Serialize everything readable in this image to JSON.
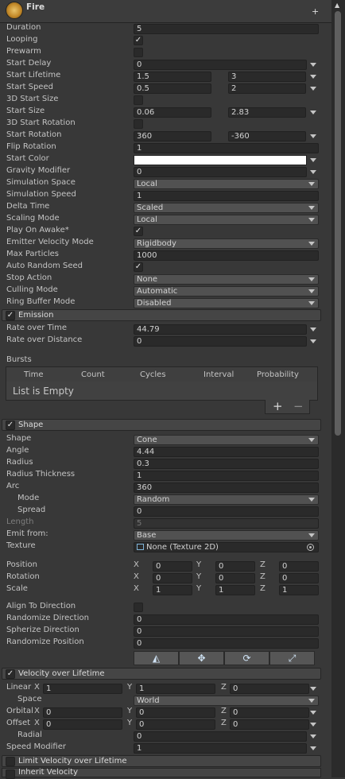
{
  "header": {
    "title": "Fire"
  },
  "main": [
    {
      "label": "Duration",
      "kind": "field",
      "value": "5"
    },
    {
      "label": "Looping",
      "kind": "check",
      "checked": true
    },
    {
      "label": "Prewarm",
      "kind": "check",
      "checked": false
    },
    {
      "label": "Start Delay",
      "kind": "field_arrow",
      "value": "0"
    },
    {
      "label": "Start Lifetime",
      "kind": "two_arrow",
      "value": "1.5",
      "value2": "3"
    },
    {
      "label": "Start Speed",
      "kind": "two_arrow",
      "value": "0.5",
      "value2": "2"
    },
    {
      "label": "3D Start Size",
      "kind": "check",
      "checked": false
    },
    {
      "label": "Start Size",
      "kind": "two_arrow",
      "value": "0.06",
      "value2": "2.83"
    },
    {
      "label": "3D Start Rotation",
      "kind": "check",
      "checked": false
    },
    {
      "label": "Start Rotation",
      "kind": "two_arrow",
      "value": "360",
      "value2": "-360"
    },
    {
      "label": "Flip Rotation",
      "kind": "field",
      "value": "1"
    },
    {
      "label": "Start Color",
      "kind": "color",
      "color": "#ffffff"
    },
    {
      "label": "Gravity Modifier",
      "kind": "field_arrow",
      "value": "0"
    },
    {
      "label": "Simulation Space",
      "kind": "dropdown",
      "value": "Local"
    },
    {
      "label": "Simulation Speed",
      "kind": "field",
      "value": "1"
    },
    {
      "label": "Delta Time",
      "kind": "dropdown",
      "value": "Scaled"
    },
    {
      "label": "Scaling Mode",
      "kind": "dropdown",
      "value": "Local"
    },
    {
      "label": "Play On Awake*",
      "kind": "check",
      "checked": true
    },
    {
      "label": "Emitter Velocity Mode",
      "kind": "dropdown",
      "value": "Rigidbody"
    },
    {
      "label": "Max Particles",
      "kind": "field",
      "value": "1000"
    },
    {
      "label": "Auto Random Seed",
      "kind": "check",
      "checked": true
    },
    {
      "label": "Stop Action",
      "kind": "dropdown",
      "value": "None"
    },
    {
      "label": "Culling Mode",
      "kind": "dropdown",
      "value": "Automatic"
    },
    {
      "label": "Ring Buffer Mode",
      "kind": "dropdown",
      "value": "Disabled"
    }
  ],
  "emission": {
    "title": "Emission",
    "rows": [
      {
        "label": "Rate over Time",
        "value": "44.79"
      },
      {
        "label": "Rate over Distance",
        "value": "0"
      }
    ],
    "bursts_label": "Bursts",
    "columns": [
      "Time",
      "Count",
      "Cycles",
      "Interval",
      "Probability"
    ],
    "empty_text": "List is Empty",
    "add": "+",
    "remove": "−"
  },
  "shape": {
    "title": "Shape",
    "rows": [
      {
        "label": "Shape",
        "kind": "dropdown",
        "value": "Cone"
      },
      {
        "label": "Angle",
        "kind": "field",
        "value": "4.44"
      },
      {
        "label": "Radius",
        "kind": "field",
        "value": "0.3"
      },
      {
        "label": "Radius Thickness",
        "kind": "field",
        "value": "1"
      },
      {
        "label": "Arc",
        "kind": "field",
        "value": "360"
      },
      {
        "label": "Mode",
        "kind": "dropdown",
        "value": "Random",
        "indent": true
      },
      {
        "label": "Spread",
        "kind": "field",
        "value": "0",
        "indent": true
      },
      {
        "label": "Length",
        "kind": "field",
        "value": "5",
        "dim": true
      },
      {
        "label": "Emit from:",
        "kind": "dropdown",
        "value": "Base"
      },
      {
        "label": "Texture",
        "kind": "object",
        "value": "None (Texture 2D)"
      }
    ],
    "vectors": [
      {
        "label": "Position",
        "x": "0",
        "y": "0",
        "z": "0"
      },
      {
        "label": "Rotation",
        "x": "0",
        "y": "0",
        "z": "0"
      },
      {
        "label": "Scale",
        "x": "1",
        "y": "1",
        "z": "1"
      }
    ],
    "axes": {
      "x": "X",
      "y": "Y",
      "z": "Z"
    },
    "after": [
      {
        "label": "Align To Direction",
        "kind": "check",
        "checked": false
      },
      {
        "label": "Randomize Direction",
        "kind": "field",
        "value": "0"
      },
      {
        "label": "Spherize Direction",
        "kind": "field",
        "value": "0"
      },
      {
        "label": "Randomize Position",
        "kind": "field",
        "value": "0"
      }
    ],
    "tools": [
      "shape-edit-icon",
      "move-icon",
      "rotate-icon",
      "scale-icon"
    ]
  },
  "velocity": {
    "title": "Velocity over Lifetime",
    "linear": {
      "label": "Linear",
      "x": "1",
      "y": "1",
      "z": "0"
    },
    "space": {
      "label": "Space",
      "value": "World"
    },
    "orbital": {
      "label": "Orbital",
      "x": "0",
      "y": "0",
      "z": "0"
    },
    "offset": {
      "label": "Offset",
      "x": "0",
      "y": "0",
      "z": "0"
    },
    "radial": {
      "label": "Radial",
      "value": "0"
    },
    "speed": {
      "label": "Speed Modifier",
      "value": "1"
    }
  },
  "limit_velocity": {
    "title": "Limit Velocity over Lifetime"
  },
  "inherit_velocity": {
    "title": "Inherit Velocity"
  },
  "check_glyph": "✓"
}
